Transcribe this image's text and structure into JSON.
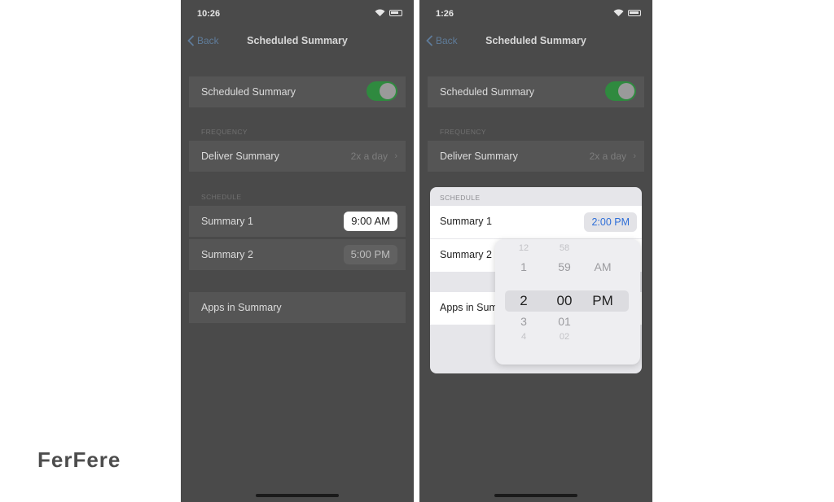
{
  "left_phone": {
    "status_time": "10:26",
    "back_label": "Back",
    "title": "Scheduled Summary",
    "scheduled_summary_label": "Scheduled Summary",
    "frequency_header": "FREQUENCY",
    "deliver_summary_label": "Deliver Summary",
    "deliver_summary_value": "2x a day",
    "schedule_header": "SCHEDULE",
    "summary1_label": "Summary 1",
    "summary1_time": "9:00 AM",
    "summary2_label": "Summary 2",
    "summary2_time": "5:00 PM",
    "apps_label": "Apps in Summary"
  },
  "right_phone": {
    "status_time": "1:26",
    "back_label": "Back",
    "title": "Scheduled Summary",
    "scheduled_summary_label": "Scheduled Summary",
    "frequency_header": "FREQUENCY",
    "deliver_summary_label": "Deliver Summary",
    "deliver_summary_value": "2x a day",
    "schedule_header": "SCHEDULE",
    "summary1_label": "Summary 1",
    "summary1_time": "2:00 PM",
    "summary2_label": "Summary 2",
    "apps_label": "Apps in Sum",
    "picker": {
      "hours": [
        "12",
        "1",
        "2",
        "3",
        "4"
      ],
      "minutes": [
        "58",
        "59",
        "00",
        "01",
        "02"
      ],
      "ampm": [
        "AM",
        "PM"
      ]
    }
  },
  "brand": "FerFere",
  "colors": {
    "toggle_on": "#2f8a3f",
    "accent_blue": "#2f6fd8",
    "dim_background": "#4a4a4a"
  }
}
